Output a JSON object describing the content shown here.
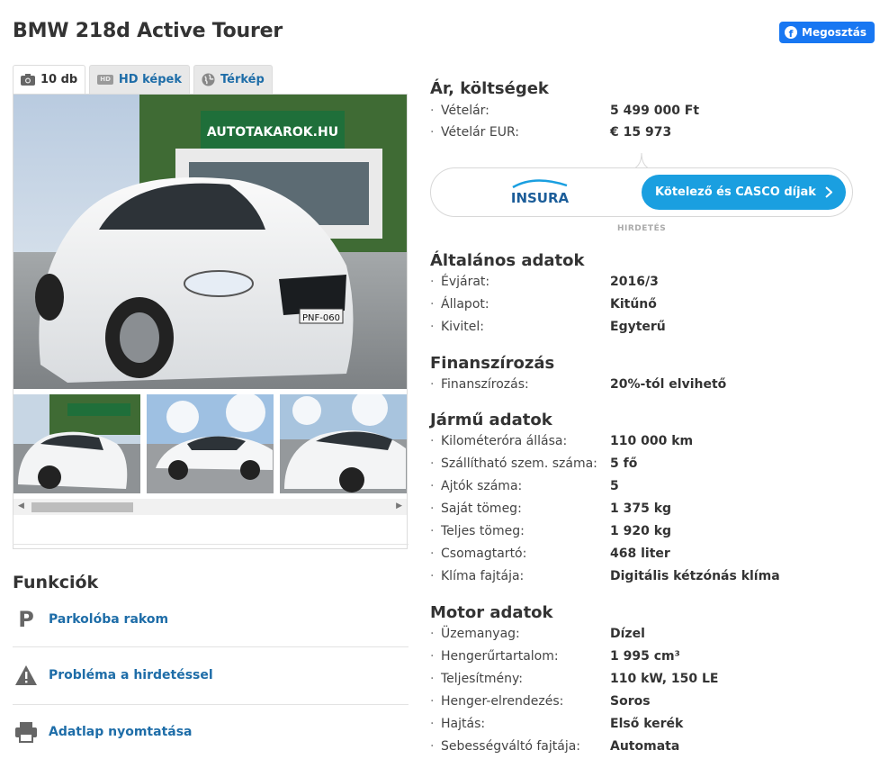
{
  "page": {
    "title": "BMW 218d Active Tourer"
  },
  "share": {
    "label": "Megosztás"
  },
  "gallery": {
    "tabs": [
      {
        "label": "10 db",
        "icon": "camera-icon"
      },
      {
        "label": "HD képek",
        "icon": "hd-icon"
      },
      {
        "label": "Térkép",
        "icon": "globe-icon"
      }
    ],
    "hd_badge": "HD",
    "sign_text": "AUTOTAKAROK.HU",
    "plate_text": "PNF-060"
  },
  "functions": {
    "title": "Funkciók",
    "items": [
      {
        "label": "Parkolóba rakom",
        "icon": "parking-icon"
      },
      {
        "label": "Probléma a hirdetéssel",
        "icon": "warning-icon"
      },
      {
        "label": "Adatlap nyomtatása",
        "icon": "printer-icon"
      }
    ]
  },
  "costs": {
    "title": "Ár, költségek",
    "rows": [
      {
        "label": "Vételár:",
        "value": "5 499 000 Ft"
      },
      {
        "label": "Vételár EUR:",
        "value": "€ 15 973"
      }
    ]
  },
  "insurance": {
    "logo_text": "INSURA",
    "button_label": "Kötelező és CASCO díjak",
    "ad_label": "HIRDETÉS",
    "brand_color": "#1a9fe0"
  },
  "general": {
    "title": "Általános adatok",
    "rows": [
      {
        "label": "Évjárat:",
        "value": "2016/3"
      },
      {
        "label": "Állapot:",
        "value": "Kitűnő"
      },
      {
        "label": "Kivitel:",
        "value": "Egyterű"
      }
    ]
  },
  "financing": {
    "title": "Finanszírozás",
    "rows": [
      {
        "label": "Finanszírozás:",
        "value": "20%-tól elvihető"
      }
    ]
  },
  "vehicle": {
    "title": "Jármű adatok",
    "rows": [
      {
        "label": "Kilométeróra állása:",
        "value": "110 000 km"
      },
      {
        "label": "Szállítható szem. száma:",
        "value": "5 fő"
      },
      {
        "label": "Ajtók száma:",
        "value": "5"
      },
      {
        "label": "Saját tömeg:",
        "value": "1 375 kg"
      },
      {
        "label": "Teljes tömeg:",
        "value": "1 920 kg"
      },
      {
        "label": "Csomagtartó:",
        "value": "468 liter"
      },
      {
        "label": "Klíma fajtája:",
        "value": "Digitális kétzónás klíma"
      }
    ]
  },
  "engine": {
    "title": "Motor adatok",
    "rows": [
      {
        "label": "Üzemanyag:",
        "value": "Dízel"
      },
      {
        "label": "Hengerűrtartalom:",
        "value": "1 995 cm³"
      },
      {
        "label": "Teljesítmény:",
        "value": "110 kW, 150 LE"
      },
      {
        "label": "Henger-elrendezés:",
        "value": "Soros"
      },
      {
        "label": "Hajtás:",
        "value": "Első kerék"
      },
      {
        "label": "Sebességváltó fajtája:",
        "value": "Automata"
      }
    ]
  },
  "colors": {
    "link": "#1e6da8",
    "facebook": "#1877f2"
  }
}
